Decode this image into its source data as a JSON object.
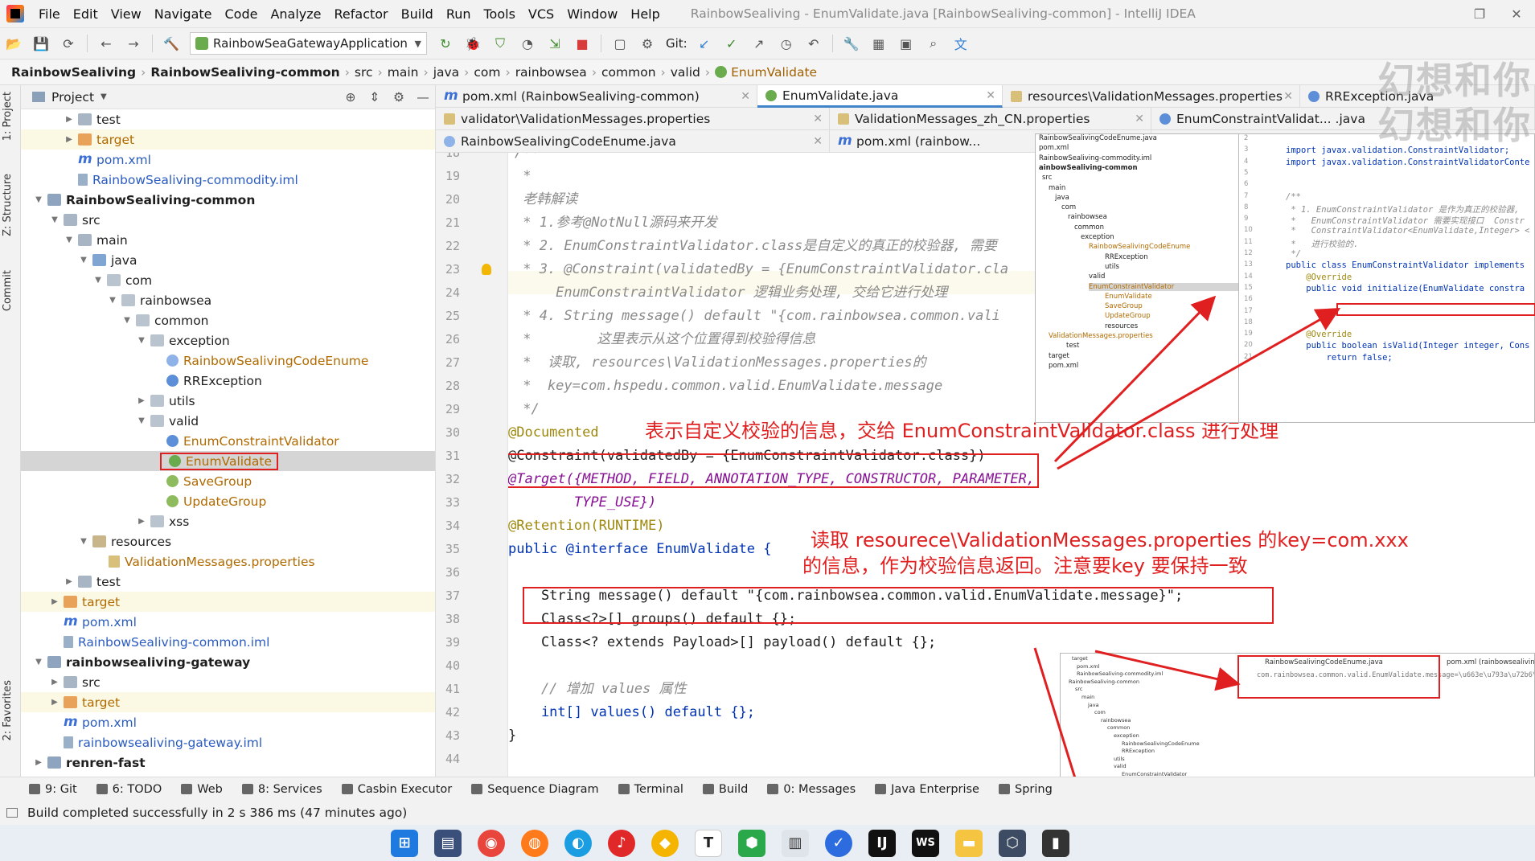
{
  "window": {
    "title": "RainbowSealiving - EnumValidate.java [RainbowSealiving-common] - IntelliJ IDEA",
    "menu": [
      "File",
      "Edit",
      "View",
      "Navigate",
      "Code",
      "Analyze",
      "Refactor",
      "Build",
      "Run",
      "Tools",
      "VCS",
      "Window",
      "Help"
    ]
  },
  "toolbar": {
    "run_config": "RainbowSeaGatewayApplication",
    "git_label": "Git:"
  },
  "breadcrumb": [
    "RainbowSealiving",
    "RainbowSealiving-common",
    "src",
    "main",
    "java",
    "com",
    "rainbowsea",
    "common",
    "valid",
    "EnumValidate"
  ],
  "left_strip": {
    "project": "1: Project",
    "structure": "Z: Structure",
    "commit": "Commit",
    "favorites": "2: Favorites"
  },
  "project_panel": {
    "title": "Project",
    "rows": [
      {
        "label": "test"
      },
      {
        "label": "target"
      },
      {
        "label": "pom.xml"
      },
      {
        "label": "RainbowSealiving-commodity.iml"
      },
      {
        "label": "RainbowSealiving-common"
      },
      {
        "label": "src"
      },
      {
        "label": "main"
      },
      {
        "label": "java"
      },
      {
        "label": "com"
      },
      {
        "label": "rainbowsea"
      },
      {
        "label": "common"
      },
      {
        "label": "exception"
      },
      {
        "label": "RainbowSealivingCodeEnume"
      },
      {
        "label": "RRException"
      },
      {
        "label": "utils"
      },
      {
        "label": "valid"
      },
      {
        "label": "EnumConstraintValidator"
      },
      {
        "label": "EnumValidate"
      },
      {
        "label": "SaveGroup"
      },
      {
        "label": "UpdateGroup"
      },
      {
        "label": "xss"
      },
      {
        "label": "resources"
      },
      {
        "label": "ValidationMessages.properties"
      },
      {
        "label": "test"
      },
      {
        "label": "target"
      },
      {
        "label": "pom.xml"
      },
      {
        "label": "RainbowSealiving-common.iml"
      },
      {
        "label": "rainbowsealiving-gateway"
      },
      {
        "label": "src"
      },
      {
        "label": "target"
      },
      {
        "label": "pom.xml"
      },
      {
        "label": "rainbowsealiving-gateway.iml"
      },
      {
        "label": "renren-fast"
      }
    ]
  },
  "tabs": {
    "row1": [
      "pom.xml (RainbowSealiving-common)",
      "EnumValidate.java",
      "resources\\ValidationMessages.properties",
      "RRException.java"
    ],
    "row2": [
      "validator\\ValidationMessages.properties",
      "ValidationMessages_zh_CN.properties",
      "EnumConstraintValidat... .java"
    ],
    "row3": [
      "RainbowSealivingCodeEnume.java",
      "pom.xml (rainbow..."
    ]
  },
  "editor": {
    "line_numbers": [
      "18",
      "19",
      "20",
      "21",
      "22",
      "23",
      "24",
      "25",
      "26",
      "27",
      "28",
      "29",
      "30",
      "31",
      "32",
      "33",
      "34",
      "35",
      "36",
      "37",
      "38",
      "39",
      "40",
      "41",
      "42",
      "43",
      "44"
    ],
    "lines": [
      "/**",
      " *",
      " 老韩解读",
      " * 1.参考@NotNull源码来开发",
      " * 2. EnumConstraintValidator.class是自定义的真正的校验器, 需要",
      " * 3. @Constraint(validatedBy = {EnumConstraintValidator.cla",
      "     EnumConstraintValidator 逻辑业务处理, 交给它进行处理",
      " * 4. String message() default \"{com.rainbowsea.common.vali",
      " *        这里表示从这个位置得到校验得信息",
      " *  读取, resources\\ValidationMessages.properties的",
      " *  key=com.hspedu.common.valid.EnumValidate.message",
      " */",
      "@Documented",
      "@Constraint(validatedBy = {EnumConstraintValidator.class})",
      "@Target({METHOD, FIELD, ANNOTATION_TYPE, CONSTRUCTOR, PARAMETER,",
      "        TYPE_USE})",
      "@Retention(RUNTIME)",
      "public @interface EnumValidate {",
      "",
      "    String message() default \"{com.rainbowsea.common.valid.EnumValidate.message}\";",
      "    Class<?>[] groups() default {};",
      "    Class<? extends Payload>[] payload() default {};",
      "",
      "    // 增加 values 属性",
      "    int[] values() default {};",
      "}",
      ""
    ]
  },
  "annotations": {
    "note1": "表示自定义校验的信息，交给 EnumConstraintValidator.class 进行处理",
    "note2_line1": "读取 resourece\\ValidationMessages.properties 的key=com.xxx",
    "note2_line2": "的信息，作为校验信息返回。注意要key 要保持一致"
  },
  "inset_tree": {
    "rows": [
      "RainbowSealivingCodeEnume.java",
      "pom.xml",
      "RainbowSealiving-commodity.iml",
      "ainbowSealiving-common",
      "src",
      "main",
      "java",
      "com",
      "rainbowsea",
      "common",
      "exception",
      "RainbowSealivingCodeEnume",
      "RRException",
      "utils",
      "valid",
      "EnumConstraintValidator",
      "EnumValidate",
      "SaveGroup",
      "UpdateGroup",
      "resources",
      "ValidationMessages.properties",
      "test",
      "target",
      "pom.xml"
    ]
  },
  "inset_code": {
    "line_numbers": [
      "2",
      "3",
      "4",
      "5",
      "6",
      "7",
      "8",
      "9",
      "10",
      "11",
      "12",
      "13",
      "14",
      "15",
      "16",
      "17",
      "18",
      "19",
      "20",
      "21"
    ],
    "lines": [
      "",
      "import javax.validation.ConstraintValidator;",
      "import javax.validation.ConstraintValidatorConte",
      "",
      "",
      "/**",
      " * 1. EnumConstraintValidator 是作为真正的校验器,",
      " *   EnumConstraintValidator 需要实现接口  Constr",
      " *   ConstraintValidator<EnumValidate,Integer> <",
      " *   进行校验的.",
      " */",
      "public class EnumConstraintValidator implements",
      "    @Override",
      "    public void initialize(EnumValidate constra",
      "",
      "",
      "",
      "    @Override",
      "    public boolean isValid(Integer integer, Cons",
      "        return false;"
    ]
  },
  "inset_props": {
    "tabs": [
      "RainbowSealivingCodeEnume.java",
      "pom.xml (rainbowsealiving-gateway)"
    ],
    "line": "com.rainbowsea.common.valid.EnumValidate.message=\\u663e\\u793a\\u72b6\\u6001",
    "tree": [
      "target",
      "pom.xml",
      "RainbowSealiving-commodity.iml",
      "RainbowSealiving-common",
      "src",
      "main",
      "java",
      "com",
      "rainbowsea",
      "common",
      "exception",
      "RainbowSealivingCodeEnume",
      "RRException",
      "utils",
      "valid",
      "EnumConstraintValidator",
      "EnumValidate",
      "SaveGroup",
      "UpdateGroup",
      "xss",
      "resources",
      "ValidationMessages.properties",
      "test",
      "target",
      "pom.xml"
    ]
  },
  "watermark": "幻想和你",
  "bottom_tools": [
    "9: Git",
    "6: TODO",
    "Web",
    "8: Services",
    "Casbin Executor",
    "Sequence Diagram",
    "Terminal",
    "Build",
    "0: Messages",
    "Java Enterprise",
    "Spring"
  ],
  "status": "Build completed successfully in 2 s 386 ms (47 minutes ago)"
}
